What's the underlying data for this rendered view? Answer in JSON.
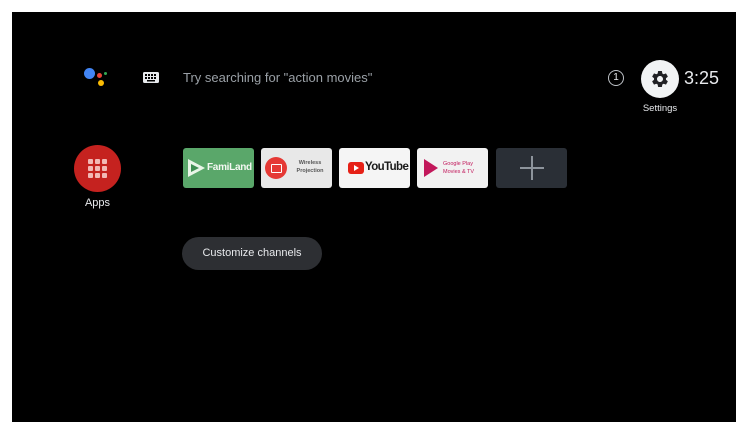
{
  "top_bar": {
    "assistant_icon": "google-assistant-icon",
    "keyboard_icon": "keyboard-icon",
    "search_hint": "Try searching for \"action movies\"",
    "notification_count": "1",
    "settings_label": "Settings",
    "clock": "3:25"
  },
  "apps": {
    "label": "Apps",
    "icon": "apps-grid-icon",
    "color": "#c5221f"
  },
  "channels": [
    {
      "name": "FamiLand"
    },
    {
      "name_line1": "Wireless",
      "name_line2": "Projection"
    },
    {
      "name": "YouTube"
    },
    {
      "name_line1": "Google Play",
      "name_line2": "Movies & TV"
    },
    {
      "icon": "plus-icon"
    }
  ],
  "customize": {
    "label": "Customize channels"
  }
}
